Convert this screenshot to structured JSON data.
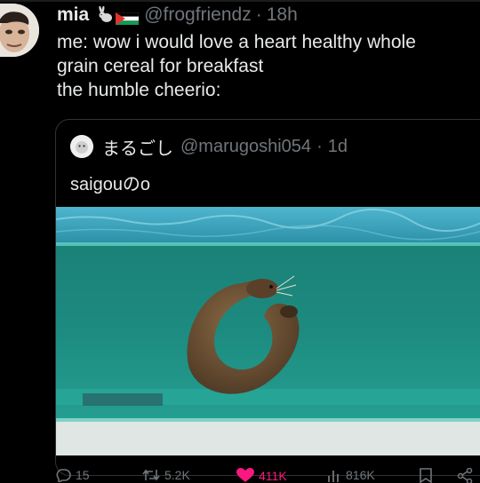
{
  "tweet": {
    "author_name": "mia",
    "author_handle": "@frogfriendz",
    "separator": "·",
    "time": "18h",
    "lines": [
      "me: wow i would love a heart healthy whole",
      "grain cereal for breakfast",
      "the humble cheerio:"
    ]
  },
  "quote": {
    "author_name": "まるごし",
    "author_handle": "@marugoshi054",
    "separator": "·",
    "time": "1d",
    "text": "saigouのo"
  },
  "actions": {
    "replies": "15",
    "retweets": "5.2K",
    "likes": "411K",
    "views": "816K"
  },
  "colors": {
    "like": "#f91880",
    "muted": "#71767b",
    "text": "#e7e9ea",
    "water": "#1f8a82"
  },
  "icons": [
    "rabbit-icon",
    "palestine-flag-icon",
    "reply-icon",
    "retweet-icon",
    "heart-icon",
    "views-icon",
    "bookmark-icon",
    "share-icon"
  ]
}
